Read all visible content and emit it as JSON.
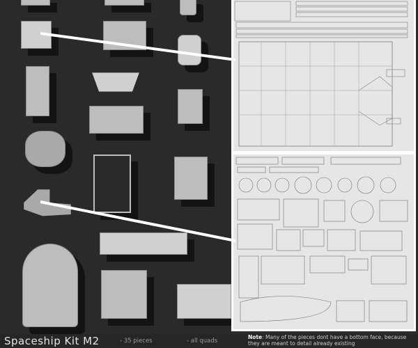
{
  "footer": {
    "title": "Spaceship Kit M2",
    "pieces": "- 35 pieces",
    "quads": "- all quads",
    "note_label": "Note",
    "note_text": ": Many of the pieces dont have a bottom face, because they are meant to detail already existing"
  },
  "colors": {
    "background": "#2b2b2b",
    "panel_border": "#ffffff",
    "uv_sheet": "#e6e6e6",
    "connector_line": "#ffffff"
  }
}
